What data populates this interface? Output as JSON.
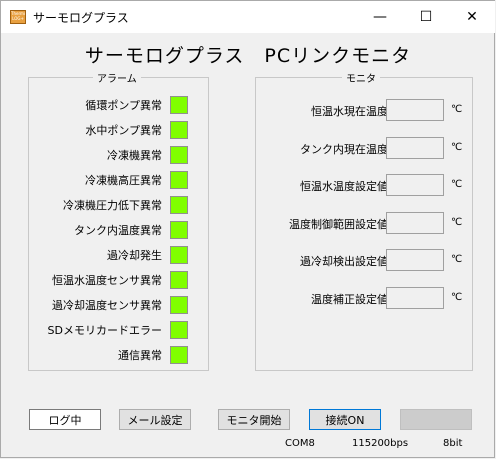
{
  "window": {
    "title": "サーモログプラス",
    "icon_label": "Thermo LOG+"
  },
  "titlebar_buttons": {
    "minimize": "—",
    "maximize": "☐",
    "close": "✕"
  },
  "main_title": "サーモログプラス　PCリンクモニタ",
  "alarm_group": {
    "label": "アラーム",
    "led_color": "#80ff00",
    "items": [
      "循環ポンプ異常",
      "水中ポンプ異常",
      "冷凍機異常",
      "冷凍機高圧異常",
      "冷凍機圧力低下異常",
      "タンク内温度異常",
      "過冷却発生",
      "恒温水温度センサ異常",
      "過冷却温度センサ異常",
      "SDメモリカードエラー",
      "通信異常"
    ]
  },
  "monitor_group": {
    "label": "モニタ",
    "unit": "℃",
    "items": [
      {
        "label": "恒温水現在温度",
        "value": ""
      },
      {
        "label": "タンク内現在温度",
        "value": ""
      },
      {
        "label": "恒温水温度設定値",
        "value": ""
      },
      {
        "label": "温度制御範囲設定値",
        "value": ""
      },
      {
        "label": "過冷却検出設定値",
        "value": ""
      },
      {
        "label": "温度補正設定値",
        "value": ""
      }
    ]
  },
  "buttons": {
    "log": "ログ中",
    "mail": "メール設定",
    "monitor_start": "モニタ開始",
    "connect": "接続ON",
    "disabled": ""
  },
  "status": {
    "port": "COM8",
    "baud": "115200bps",
    "bits": "8bit"
  }
}
